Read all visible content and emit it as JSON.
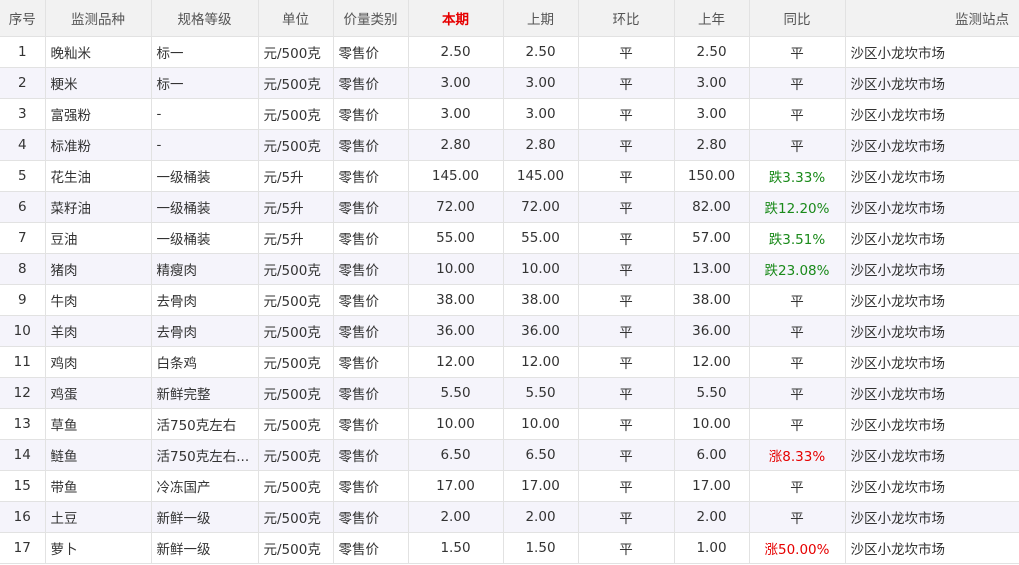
{
  "columns": [
    "序号",
    "监测品种",
    "规格等级",
    "单位",
    "价量类别",
    "本期",
    "上期",
    "环比",
    "上年",
    "同比",
    "监测站点"
  ],
  "rows": [
    {
      "seq": "1",
      "variety": "晚籼米",
      "grade": "标一",
      "unit": "元/500克",
      "category": "零售价",
      "current": "2.50",
      "previous": "2.50",
      "mom": "平",
      "last_year": "2.50",
      "yoy": "平",
      "yoy_trend": "flat",
      "station": "沙区小龙坎市场"
    },
    {
      "seq": "2",
      "variety": "粳米",
      "grade": "标一",
      "unit": "元/500克",
      "category": "零售价",
      "current": "3.00",
      "previous": "3.00",
      "mom": "平",
      "last_year": "3.00",
      "yoy": "平",
      "yoy_trend": "flat",
      "station": "沙区小龙坎市场"
    },
    {
      "seq": "3",
      "variety": "富强粉",
      "grade": "-",
      "unit": "元/500克",
      "category": "零售价",
      "current": "3.00",
      "previous": "3.00",
      "mom": "平",
      "last_year": "3.00",
      "yoy": "平",
      "yoy_trend": "flat",
      "station": "沙区小龙坎市场"
    },
    {
      "seq": "4",
      "variety": "标准粉",
      "grade": "-",
      "unit": "元/500克",
      "category": "零售价",
      "current": "2.80",
      "previous": "2.80",
      "mom": "平",
      "last_year": "2.80",
      "yoy": "平",
      "yoy_trend": "flat",
      "station": "沙区小龙坎市场"
    },
    {
      "seq": "5",
      "variety": "花生油",
      "grade": "一级桶装",
      "unit": "元/5升",
      "category": "零售价",
      "current": "145.00",
      "previous": "145.00",
      "mom": "平",
      "last_year": "150.00",
      "yoy": "跌3.33%",
      "yoy_trend": "down",
      "station": "沙区小龙坎市场"
    },
    {
      "seq": "6",
      "variety": "菜籽油",
      "grade": "一级桶装",
      "unit": "元/5升",
      "category": "零售价",
      "current": "72.00",
      "previous": "72.00",
      "mom": "平",
      "last_year": "82.00",
      "yoy": "跌12.20%",
      "yoy_trend": "down",
      "station": "沙区小龙坎市场"
    },
    {
      "seq": "7",
      "variety": "豆油",
      "grade": "一级桶装",
      "unit": "元/5升",
      "category": "零售价",
      "current": "55.00",
      "previous": "55.00",
      "mom": "平",
      "last_year": "57.00",
      "yoy": "跌3.51%",
      "yoy_trend": "down",
      "station": "沙区小龙坎市场"
    },
    {
      "seq": "8",
      "variety": "猪肉",
      "grade": "精瘦肉",
      "unit": "元/500克",
      "category": "零售价",
      "current": "10.00",
      "previous": "10.00",
      "mom": "平",
      "last_year": "13.00",
      "yoy": "跌23.08%",
      "yoy_trend": "down",
      "station": "沙区小龙坎市场"
    },
    {
      "seq": "9",
      "variety": "牛肉",
      "grade": "去骨肉",
      "unit": "元/500克",
      "category": "零售价",
      "current": "38.00",
      "previous": "38.00",
      "mom": "平",
      "last_year": "38.00",
      "yoy": "平",
      "yoy_trend": "flat",
      "station": "沙区小龙坎市场"
    },
    {
      "seq": "10",
      "variety": "羊肉",
      "grade": "去骨肉",
      "unit": "元/500克",
      "category": "零售价",
      "current": "36.00",
      "previous": "36.00",
      "mom": "平",
      "last_year": "36.00",
      "yoy": "平",
      "yoy_trend": "flat",
      "station": "沙区小龙坎市场"
    },
    {
      "seq": "11",
      "variety": "鸡肉",
      "grade": "白条鸡",
      "unit": "元/500克",
      "category": "零售价",
      "current": "12.00",
      "previous": "12.00",
      "mom": "平",
      "last_year": "12.00",
      "yoy": "平",
      "yoy_trend": "flat",
      "station": "沙区小龙坎市场"
    },
    {
      "seq": "12",
      "variety": "鸡蛋",
      "grade": "新鲜完整",
      "unit": "元/500克",
      "category": "零售价",
      "current": "5.50",
      "previous": "5.50",
      "mom": "平",
      "last_year": "5.50",
      "yoy": "平",
      "yoy_trend": "flat",
      "station": "沙区小龙坎市场"
    },
    {
      "seq": "13",
      "variety": "草鱼",
      "grade": "活750克左右",
      "unit": "元/500克",
      "category": "零售价",
      "current": "10.00",
      "previous": "10.00",
      "mom": "平",
      "last_year": "10.00",
      "yoy": "平",
      "yoy_trend": "flat",
      "station": "沙区小龙坎市场"
    },
    {
      "seq": "14",
      "variety": "鲢鱼",
      "grade": "活750克左右...",
      "unit": "元/500克",
      "category": "零售价",
      "current": "6.50",
      "previous": "6.50",
      "mom": "平",
      "last_year": "6.00",
      "yoy": "涨8.33%",
      "yoy_trend": "up",
      "station": "沙区小龙坎市场"
    },
    {
      "seq": "15",
      "variety": "带鱼",
      "grade": "冷冻国产",
      "unit": "元/500克",
      "category": "零售价",
      "current": "17.00",
      "previous": "17.00",
      "mom": "平",
      "last_year": "17.00",
      "yoy": "平",
      "yoy_trend": "flat",
      "station": "沙区小龙坎市场"
    },
    {
      "seq": "16",
      "variety": "土豆",
      "grade": "新鲜一级",
      "unit": "元/500克",
      "category": "零售价",
      "current": "2.00",
      "previous": "2.00",
      "mom": "平",
      "last_year": "2.00",
      "yoy": "平",
      "yoy_trend": "flat",
      "station": "沙区小龙坎市场"
    },
    {
      "seq": "17",
      "variety": "萝卜",
      "grade": "新鲜一级",
      "unit": "元/500克",
      "category": "零售价",
      "current": "1.50",
      "previous": "1.50",
      "mom": "平",
      "last_year": "1.00",
      "yoy": "涨50.00%",
      "yoy_trend": "up",
      "station": "沙区小龙坎市场"
    }
  ],
  "colors": {
    "up": "#e60000",
    "down": "#1a8a1a",
    "header_bg": "#f2f2f2",
    "stripe_bg": "#f5f4fb"
  }
}
